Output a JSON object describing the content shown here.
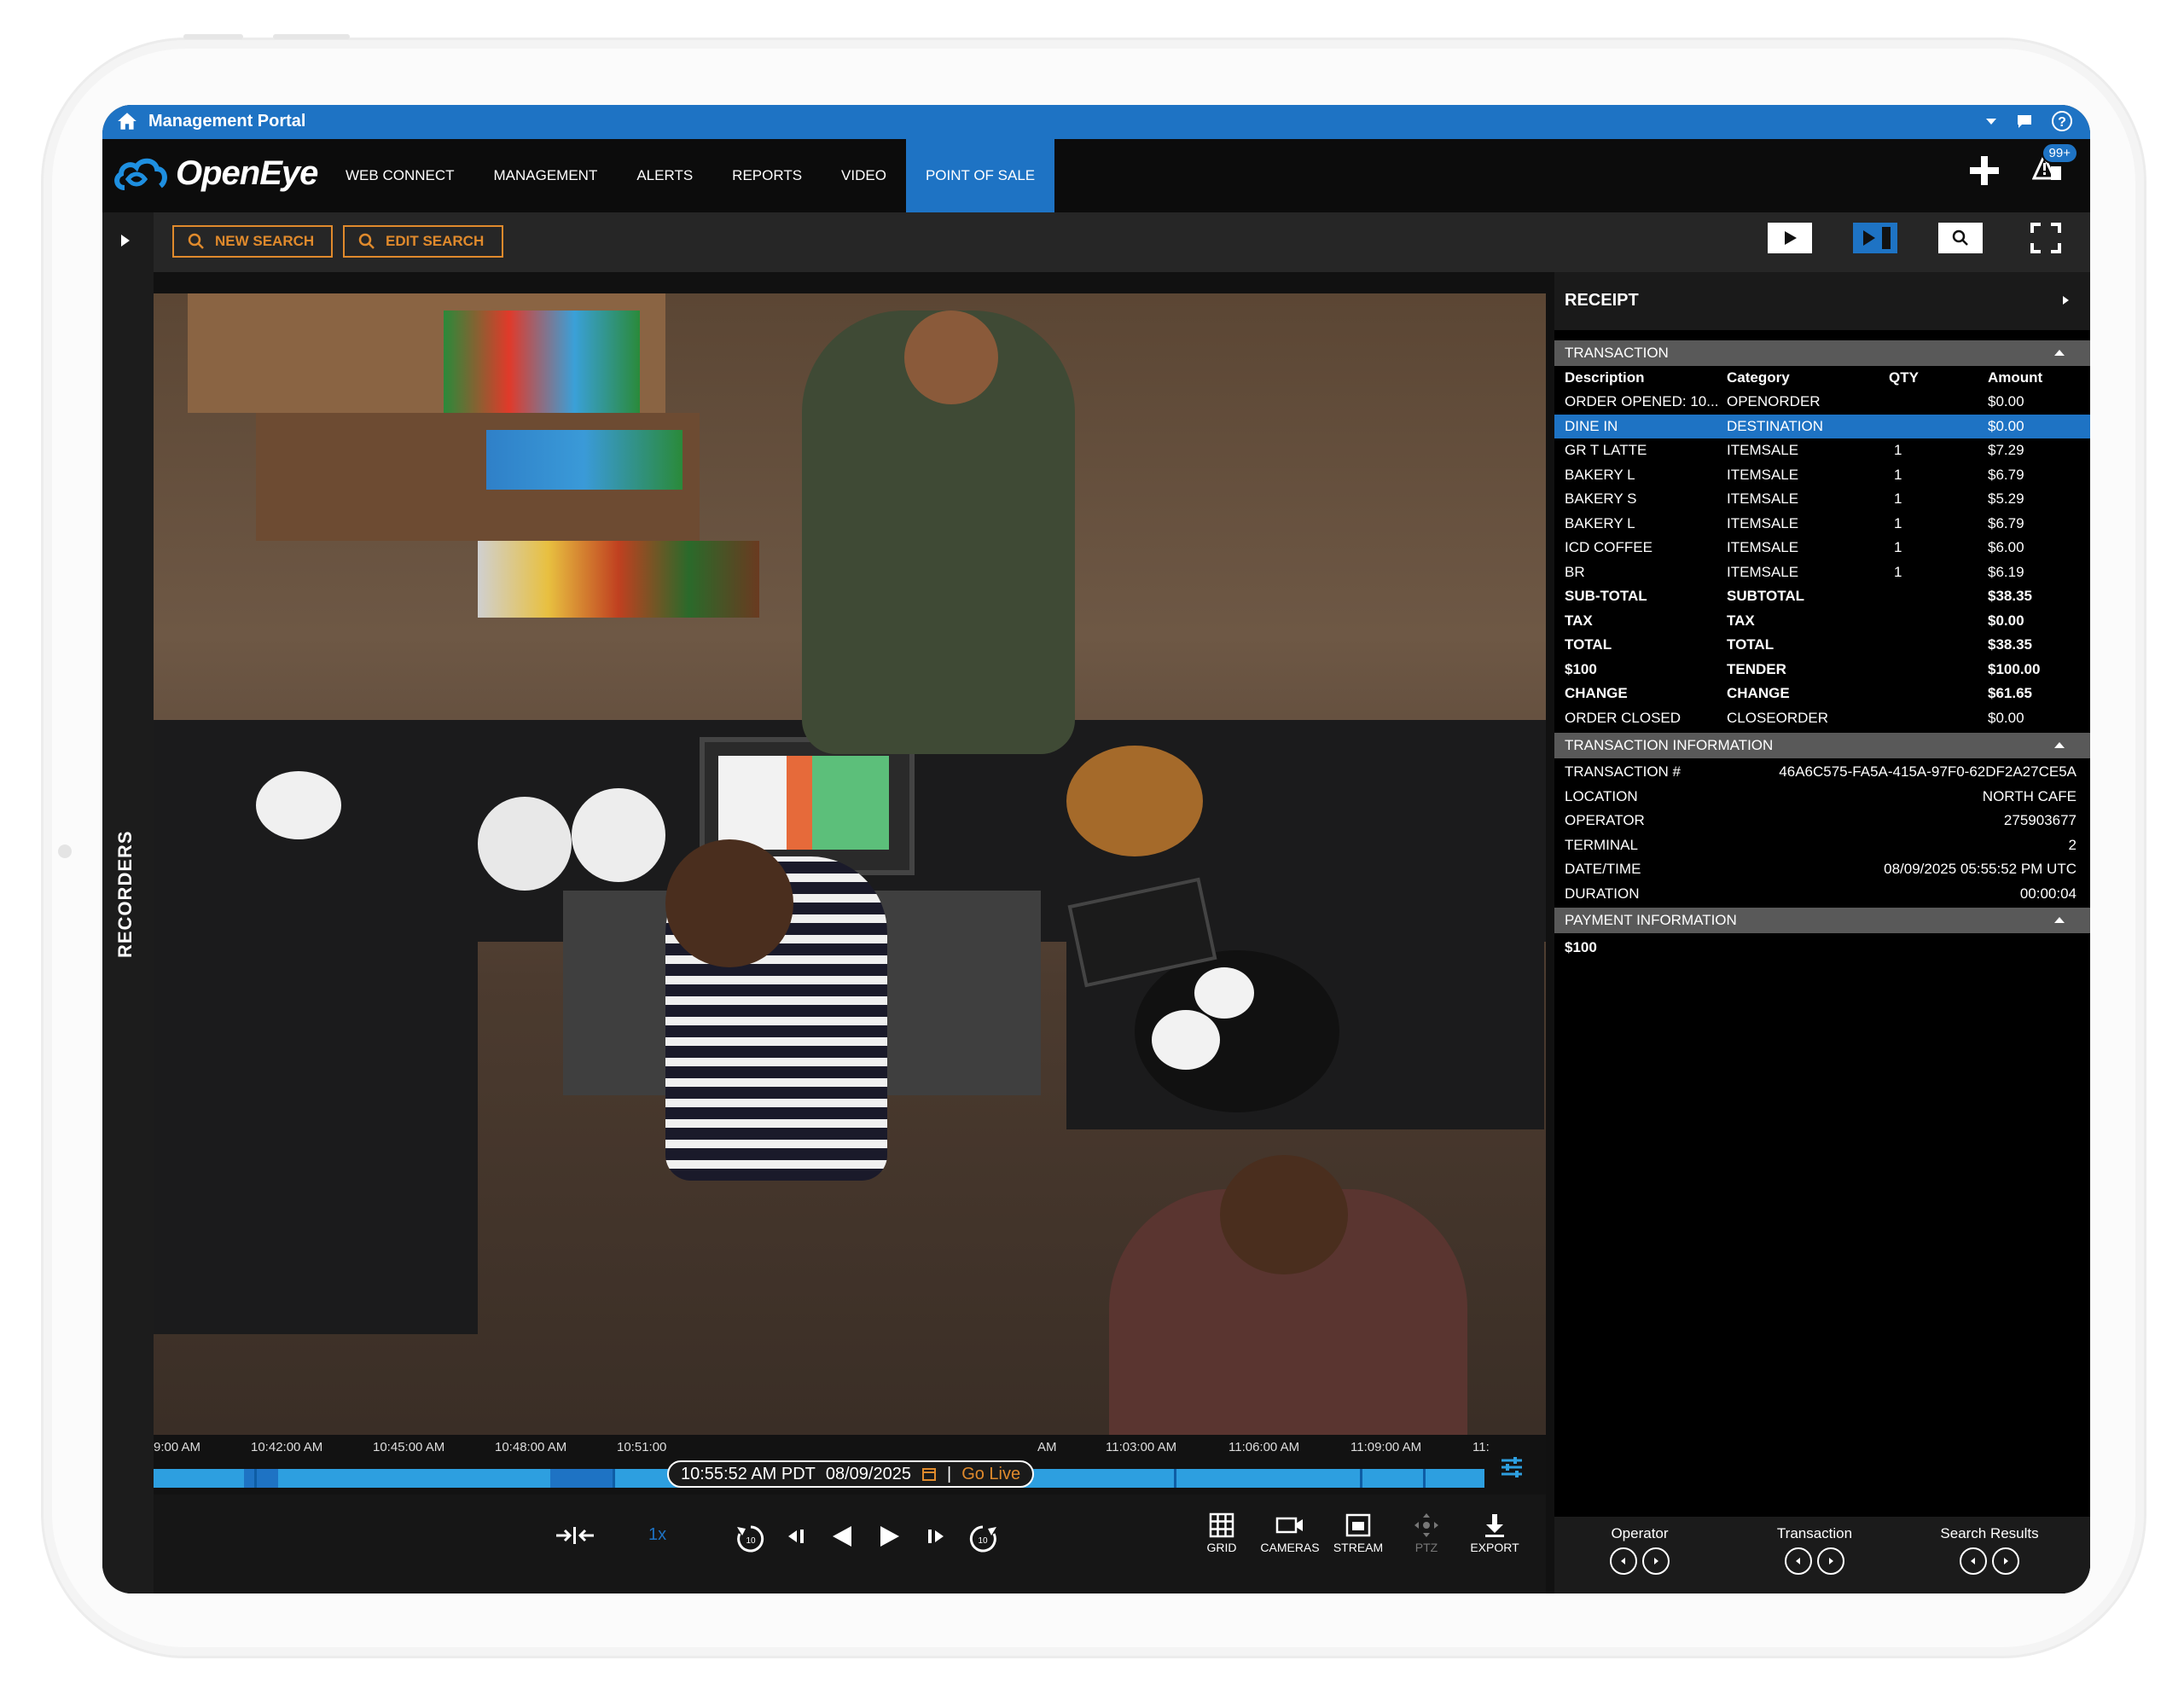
{
  "window": {
    "title": "Management Portal"
  },
  "brand": {
    "name": "OpenEye"
  },
  "nav": {
    "items": [
      "WEB CONNECT",
      "MANAGEMENT",
      "ALERTS",
      "REPORTS",
      "VIDEO",
      "POINT OF SALE"
    ],
    "active": "POINT OF SALE",
    "notification_badge": "99+"
  },
  "toolbar": {
    "new_search": "NEW SEARCH",
    "edit_search": "EDIT SEARCH"
  },
  "sidebar": {
    "label": "RECORDERS"
  },
  "timeline": {
    "labels": [
      "9:00 AM",
      "10:42:00 AM",
      "10:45:00 AM",
      "10:48:00 AM",
      "10:51:00",
      "AM",
      "11:03:00 AM",
      "11:06:00 AM",
      "11:09:00 AM",
      "11:"
    ],
    "current_time": "10:55:52 AM PDT",
    "current_date": "08/09/2025",
    "separator": "|",
    "go_live": "Go Live"
  },
  "playback": {
    "speed": "1x",
    "buttons": {
      "grid": "GRID",
      "cameras": "CAMERAS",
      "stream": "STREAM",
      "ptz": "PTZ",
      "export": "EXPORT"
    }
  },
  "receipt": {
    "title": "RECEIPT",
    "transaction_header": "TRANSACTION",
    "columns": [
      "Description",
      "Category",
      "QTY",
      "Amount"
    ],
    "rows": [
      {
        "desc": "ORDER OPENED: 10...",
        "cat": "OPENORDER",
        "qty": "",
        "amt": "$0.00",
        "bold": false,
        "highlight": false
      },
      {
        "desc": "DINE IN",
        "cat": "DESTINATION",
        "qty": "",
        "amt": "$0.00",
        "bold": false,
        "highlight": true
      },
      {
        "desc": "GR T LATTE",
        "cat": "ITEMSALE",
        "qty": "1",
        "amt": "$7.29",
        "bold": false,
        "highlight": false
      },
      {
        "desc": "BAKERY L",
        "cat": "ITEMSALE",
        "qty": "1",
        "amt": "$6.79",
        "bold": false,
        "highlight": false
      },
      {
        "desc": "BAKERY S",
        "cat": "ITEMSALE",
        "qty": "1",
        "amt": "$5.29",
        "bold": false,
        "highlight": false
      },
      {
        "desc": "BAKERY L",
        "cat": "ITEMSALE",
        "qty": "1",
        "amt": "$6.79",
        "bold": false,
        "highlight": false
      },
      {
        "desc": "ICD COFFEE",
        "cat": "ITEMSALE",
        "qty": "1",
        "amt": "$6.00",
        "bold": false,
        "highlight": false
      },
      {
        "desc": "BR",
        "cat": "ITEMSALE",
        "qty": "1",
        "amt": "$6.19",
        "bold": false,
        "highlight": false
      },
      {
        "desc": "SUB-TOTAL",
        "cat": "SUBTOTAL",
        "qty": "",
        "amt": "$38.35",
        "bold": true,
        "highlight": false
      },
      {
        "desc": "TAX",
        "cat": "TAX",
        "qty": "",
        "amt": "$0.00",
        "bold": true,
        "highlight": false
      },
      {
        "desc": "TOTAL",
        "cat": "TOTAL",
        "qty": "",
        "amt": "$38.35",
        "bold": true,
        "highlight": false
      },
      {
        "desc": "$100",
        "cat": "TENDER",
        "qty": "",
        "amt": "$100.00",
        "bold": true,
        "highlight": false
      },
      {
        "desc": "CHANGE",
        "cat": "CHANGE",
        "qty": "",
        "amt": "$61.65",
        "bold": true,
        "highlight": false
      },
      {
        "desc": "ORDER CLOSED",
        "cat": "CLOSEORDER",
        "qty": "",
        "amt": "$0.00",
        "bold": false,
        "highlight": false
      }
    ],
    "info_header": "TRANSACTION INFORMATION",
    "info": [
      {
        "key": "TRANSACTION #",
        "value": "46A6C575-FA5A-415A-97F0-62DF2A27CE5A"
      },
      {
        "key": "LOCATION",
        "value": "NORTH CAFE"
      },
      {
        "key": "OPERATOR",
        "value": "275903677"
      },
      {
        "key": "TERMINAL",
        "value": "2"
      },
      {
        "key": "DATE/TIME",
        "value": "08/09/2025  05:55:52 PM UTC"
      },
      {
        "key": "DURATION",
        "value": "00:00:04"
      }
    ],
    "payment_header": "PAYMENT INFORMATION",
    "payment_value": "$100"
  },
  "footer_nav": {
    "operator": "Operator",
    "transaction": "Transaction",
    "search_results": "Search Results"
  },
  "colors": {
    "accent_blue": "#1e73c4",
    "accent_orange": "#e08a2c",
    "timeline_blue": "#2d9fe0"
  }
}
